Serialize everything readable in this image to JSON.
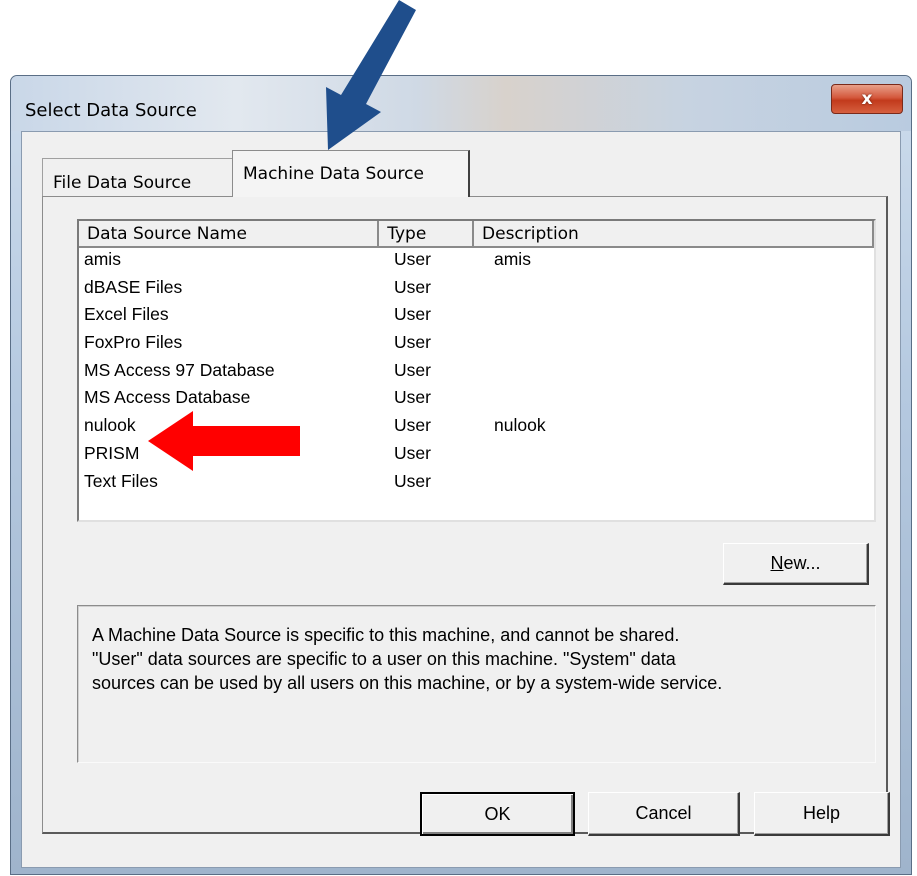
{
  "window": {
    "title": "Select Data Source",
    "close_glyph": "x"
  },
  "tabs": [
    {
      "label": "File Data Source",
      "selected": false
    },
    {
      "label": "Machine Data Source",
      "selected": true
    }
  ],
  "list": {
    "columns": [
      "Data Source Name",
      "Type",
      "Description"
    ],
    "rows": [
      {
        "name": "amis",
        "type": "User",
        "description": "amis"
      },
      {
        "name": "dBASE Files",
        "type": "User",
        "description": ""
      },
      {
        "name": "Excel Files",
        "type": "User",
        "description": ""
      },
      {
        "name": "FoxPro Files",
        "type": "User",
        "description": ""
      },
      {
        "name": "MS Access 97 Database",
        "type": "User",
        "description": ""
      },
      {
        "name": "MS Access Database",
        "type": "User",
        "description": ""
      },
      {
        "name": "nulook",
        "type": "User",
        "description": "nulook"
      },
      {
        "name": "PRISM",
        "type": "User",
        "description": ""
      },
      {
        "name": "Text Files",
        "type": "User",
        "description": ""
      }
    ]
  },
  "buttons": {
    "new_label_accel": "N",
    "new_label_rest": "ew...",
    "ok": "OK",
    "cancel": "Cancel",
    "help": "Help"
  },
  "info": {
    "lines": [
      "A Machine Data Source is specific to this machine, and cannot be shared.",
      "\"User\" data sources are specific to a user on this machine.  \"System\" data",
      "sources can be used by all users on this machine, or by a system-wide service."
    ]
  },
  "annotations": {
    "blue_arrow_color": "#1f4e8c",
    "red_arrow_color": "#ff0000"
  }
}
